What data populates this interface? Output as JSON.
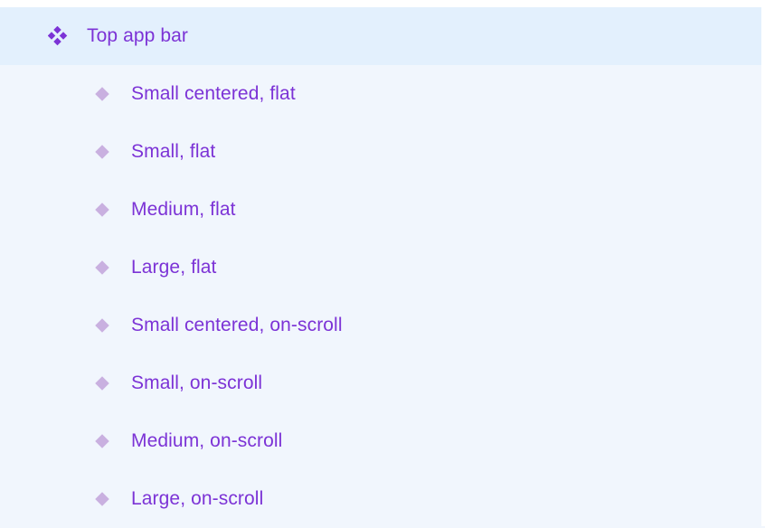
{
  "layers": {
    "parent": {
      "label": "Top app bar",
      "icon": "component-set-icon",
      "icon_color": "#7c33d6",
      "selected": true
    },
    "children": [
      {
        "label": "Small centered, flat",
        "icon": "component-instance-icon"
      },
      {
        "label": "Small, flat",
        "icon": "component-instance-icon"
      },
      {
        "label": "Medium, flat",
        "icon": "component-instance-icon"
      },
      {
        "label": "Large, flat",
        "icon": "component-instance-icon"
      },
      {
        "label": "Small centered, on-scroll",
        "icon": "component-instance-icon"
      },
      {
        "label": "Small, on-scroll",
        "icon": "component-instance-icon"
      },
      {
        "label": "Medium, on-scroll",
        "icon": "component-instance-icon"
      },
      {
        "label": "Large, on-scroll",
        "icon": "component-instance-icon"
      }
    ],
    "child_icon_color": "#c9b0e0",
    "text_color": "#7c33d6",
    "selected_row_color": "#e3f0fd",
    "panel_background": "#f1f6fd"
  }
}
